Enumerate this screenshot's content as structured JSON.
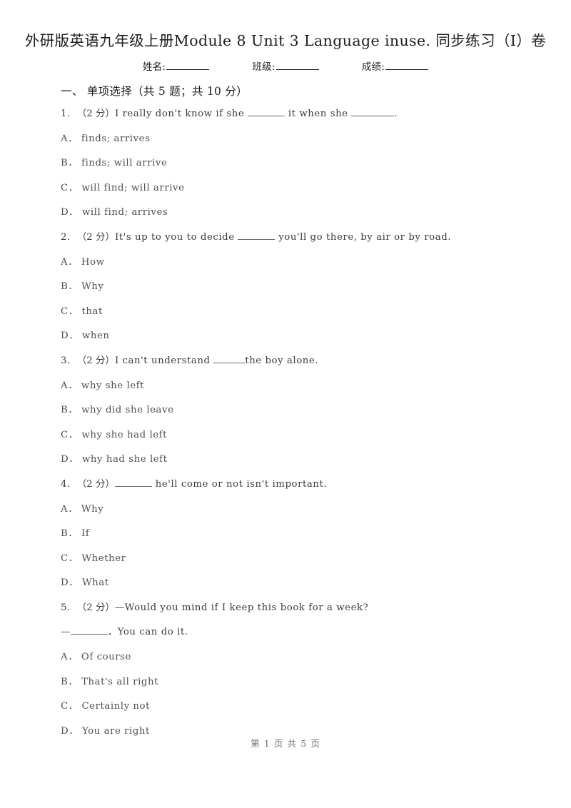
{
  "document": {
    "title": "外研版英语九年级上册Module 8 Unit 3 Language inuse. 同步练习（I）卷",
    "meta": {
      "name_label": "姓名:",
      "class_label": "班级:",
      "score_label": "成绩:"
    },
    "footer": "第 1 页 共 5 页"
  },
  "sections": [
    {
      "heading": "一、 单项选择（共 5 题；共 10 分）",
      "questions": [
        {
          "number": "1.",
          "points": "（2 分）",
          "stem_pre": "I really don't know if she ",
          "stem_mid": " it when she ",
          "stem_post": ".",
          "options": [
            {
              "label": "A．",
              "text": "finds; arrives"
            },
            {
              "label": "B．",
              "text": "finds; will arrive"
            },
            {
              "label": "C．",
              "text": "will find; will arrive"
            },
            {
              "label": "D．",
              "text": "will find; arrives"
            }
          ]
        },
        {
          "number": "2.",
          "points": "（2 分）",
          "stem_pre": "It's up to you to decide ",
          "stem_post": " you'll go there, by air or by road.",
          "options": [
            {
              "label": "A．",
              "text": "How"
            },
            {
              "label": "B．",
              "text": "Why"
            },
            {
              "label": "C．",
              "text": "that"
            },
            {
              "label": "D．",
              "text": "when"
            }
          ]
        },
        {
          "number": "3.",
          "points": "（2 分）",
          "stem_pre": "I can't understand ",
          "stem_post": "the boy alone.",
          "options": [
            {
              "label": "A．",
              "text": "why she left"
            },
            {
              "label": "B．",
              "text": "why did she leave"
            },
            {
              "label": "C．",
              "text": "why she had left"
            },
            {
              "label": "D．",
              "text": "why had she left"
            }
          ]
        },
        {
          "number": "4.",
          "points": "（2 分）",
          "stem_pre": "",
          "stem_post": " he'll come or not isn't important.",
          "options": [
            {
              "label": "A．",
              "text": "Why"
            },
            {
              "label": "B．",
              "text": "If"
            },
            {
              "label": "C．",
              "text": "Whether"
            },
            {
              "label": "D．",
              "text": "What"
            }
          ]
        },
        {
          "number": "5.",
          "points": "（2 分）",
          "stem_pre": "—Would you mind if I keep this book for a week?",
          "stem_line2_pre": "—",
          "stem_line2_post": "．You can do it.",
          "options": [
            {
              "label": "A．",
              "text": "Of course"
            },
            {
              "label": "B．",
              "text": "That's all right"
            },
            {
              "label": "C．",
              "text": "Certainly not"
            },
            {
              "label": "D．",
              "text": "You are right"
            }
          ]
        }
      ]
    }
  ]
}
